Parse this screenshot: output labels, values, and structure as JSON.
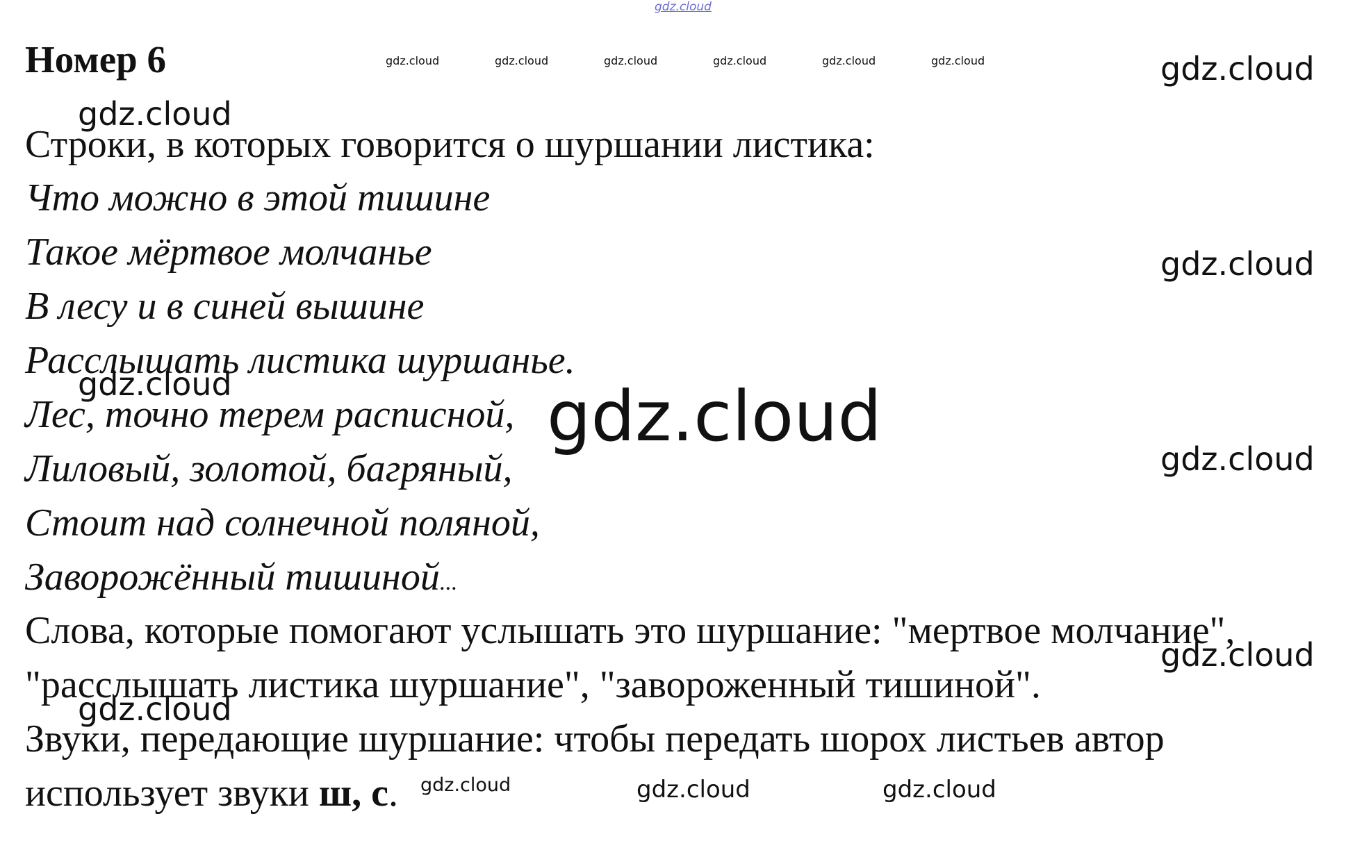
{
  "heading": "Номер 6",
  "intro": "Строки, в которых говорится о шуршании листика:",
  "poem_lines": [
    "Что можно в этой тишине",
    "Такое мёртвое молчанье",
    "В лесу и в синей вышине",
    "Расслышать листика шуршанье.",
    "Лес, точно терем расписной,",
    "Лиловый, золотой, багряный,",
    "Стоит над солнечной поляной,",
    "Заворожённый тишиной"
  ],
  "poem_ellipsis": "...",
  "words_paragraph": [
    "Слова, которые помогают услышать это шуршание: \"мертвое молчание\",",
    "\"расслышать листика шуршание\", \"завороженный тишиной\"."
  ],
  "sounds_paragraph": {
    "line1": "Звуки, передающие шуршание: чтобы передать шорох листьев автор",
    "line2_prefix": "использует звуки ",
    "line2_bold": "ш, с",
    "line2_suffix": "."
  },
  "watermark": "gdz.cloud",
  "colors": {
    "text": "#111111",
    "watermark_top": "#6b6bd6"
  }
}
